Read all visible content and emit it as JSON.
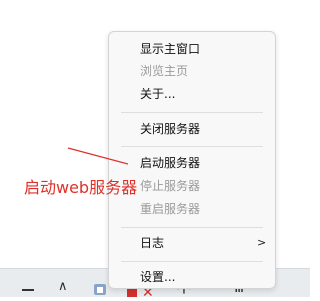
{
  "context_menu": {
    "items": [
      {
        "label": "显示主窗口",
        "enabled": true
      },
      {
        "label": "浏览主页",
        "enabled": false
      },
      {
        "label": "关于...",
        "enabled": true
      },
      {
        "label": "关闭服务器",
        "enabled": true
      },
      {
        "label": "启动服务器",
        "enabled": true
      },
      {
        "label": "停止服务器",
        "enabled": false
      },
      {
        "label": "重启服务器",
        "enabled": false
      },
      {
        "label": "日志",
        "enabled": true,
        "submenu_arrow": ">"
      },
      {
        "label": "设置...",
        "enabled": true
      }
    ]
  },
  "annotation": {
    "text": "启动web服务器",
    "color": "#e0302a"
  },
  "colors": {
    "menu_bg": "#f8f8f8",
    "disabled_text": "#9a9a9a",
    "annotation": "#e0302a"
  }
}
